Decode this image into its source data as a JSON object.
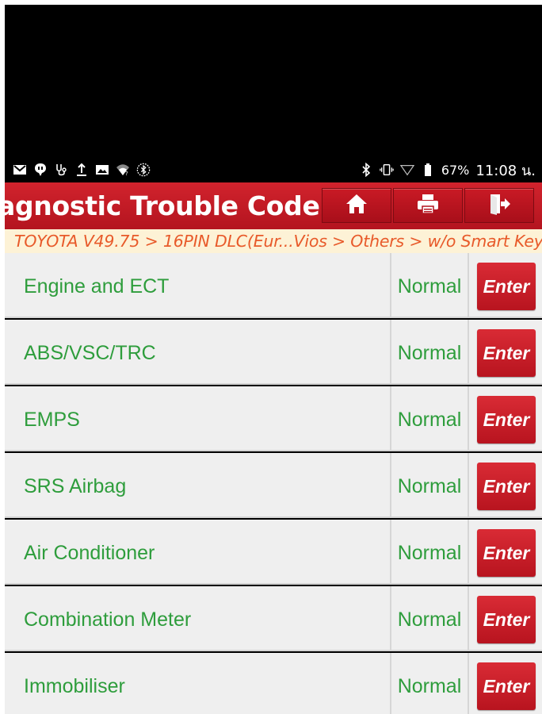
{
  "status_bar": {
    "left_icons": [
      "gmail-icon",
      "chat-icon",
      "stethoscope-icon",
      "upload-icon",
      "image-icon",
      "wifi-question-icon",
      "bluetooth-circle-icon"
    ],
    "right_icons": [
      "bluetooth-icon",
      "vibrate-icon",
      "signal-icon",
      "battery-icon"
    ],
    "battery": "67%",
    "time": "11:08 น."
  },
  "header": {
    "title": "iagnostic Trouble Code",
    "buttons": [
      {
        "name": "home",
        "icon": "home-icon"
      },
      {
        "name": "print",
        "icon": "printer-icon"
      },
      {
        "name": "exit",
        "icon": "exit-icon"
      }
    ]
  },
  "breadcrumb": "TOYOTA V49.75 > 16PIN DLC(Eur...Vios > Others > w/o Smart Key",
  "systems": [
    {
      "name": "Engine and ECT",
      "status": "Normal",
      "action": "Enter"
    },
    {
      "name": "ABS/VSC/TRC",
      "status": "Normal",
      "action": "Enter"
    },
    {
      "name": "EMPS",
      "status": "Normal",
      "action": "Enter"
    },
    {
      "name": "SRS Airbag",
      "status": "Normal",
      "action": "Enter"
    },
    {
      "name": "Air Conditioner",
      "status": "Normal",
      "action": "Enter"
    },
    {
      "name": "Combination Meter",
      "status": "Normal",
      "action": "Enter"
    },
    {
      "name": "Immobiliser",
      "status": "Normal",
      "action": "Enter"
    }
  ],
  "colors": {
    "header_red": "#c41c27",
    "text_green": "#2e9d3c",
    "breadcrumb_orange": "#e85a2a",
    "breadcrumb_bg": "#fdf2d6"
  }
}
